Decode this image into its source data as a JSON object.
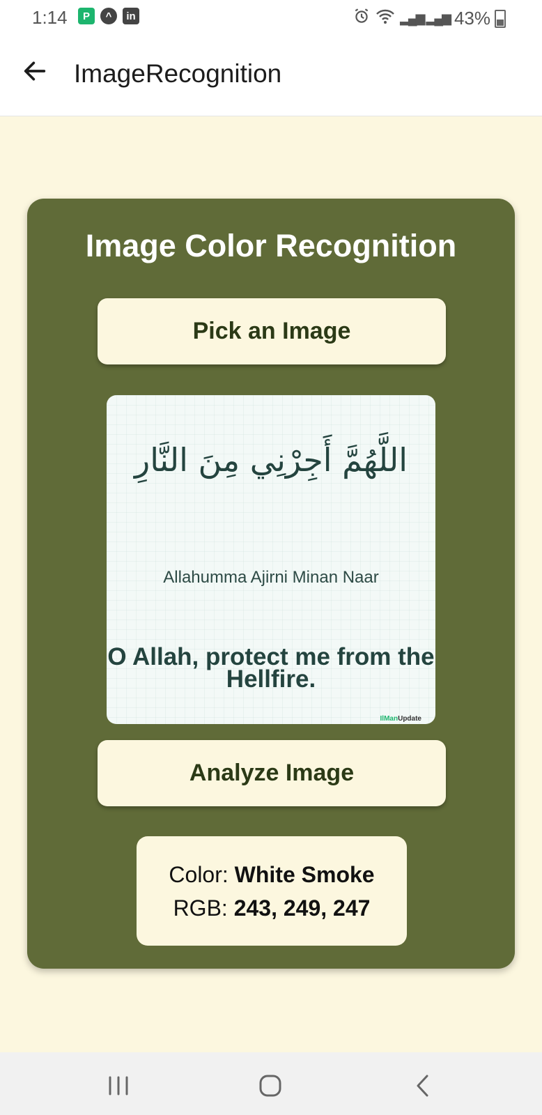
{
  "status_bar": {
    "time": "1:14",
    "notification_icons": [
      {
        "name": "paytm-p-icon",
        "glyph": "P"
      },
      {
        "name": "alert-circle-icon",
        "glyph": "^"
      },
      {
        "name": "linkedin-icon",
        "glyph": "in"
      }
    ],
    "signal_glyph": "▂▄▆ ▂▄▆",
    "battery_text": "43%"
  },
  "app_bar": {
    "title": "ImageRecognition",
    "back_icon": "arrow-left-icon"
  },
  "card": {
    "title": "Image Color Recognition",
    "pick_button_label": "Pick an Image",
    "analyze_button_label": "Analyze Image",
    "image": {
      "arabic_text": "اللَّهُمَّ أَجِرْنِي مِنَ النَّارِ",
      "transliteration": "Allahumma Ajirni Minan Naar",
      "translation": "O Allah, protect me from the Hellfire.",
      "watermark_accent": "IlMan",
      "watermark_rest": "Update"
    },
    "result": {
      "color_label": "Color:",
      "color_value": "White Smoke",
      "rgb_label": "RGB:",
      "rgb_value": "243, 249, 247"
    }
  },
  "nav_bar": {
    "recent_icon": "recent-apps-icon",
    "home_icon": "home-icon",
    "back_icon": "back-chevron-icon"
  },
  "colors": {
    "card": "#606b38",
    "background": "#fcf7df",
    "button_text": "#2b3a16",
    "sample_color": "#f3f9f7"
  }
}
